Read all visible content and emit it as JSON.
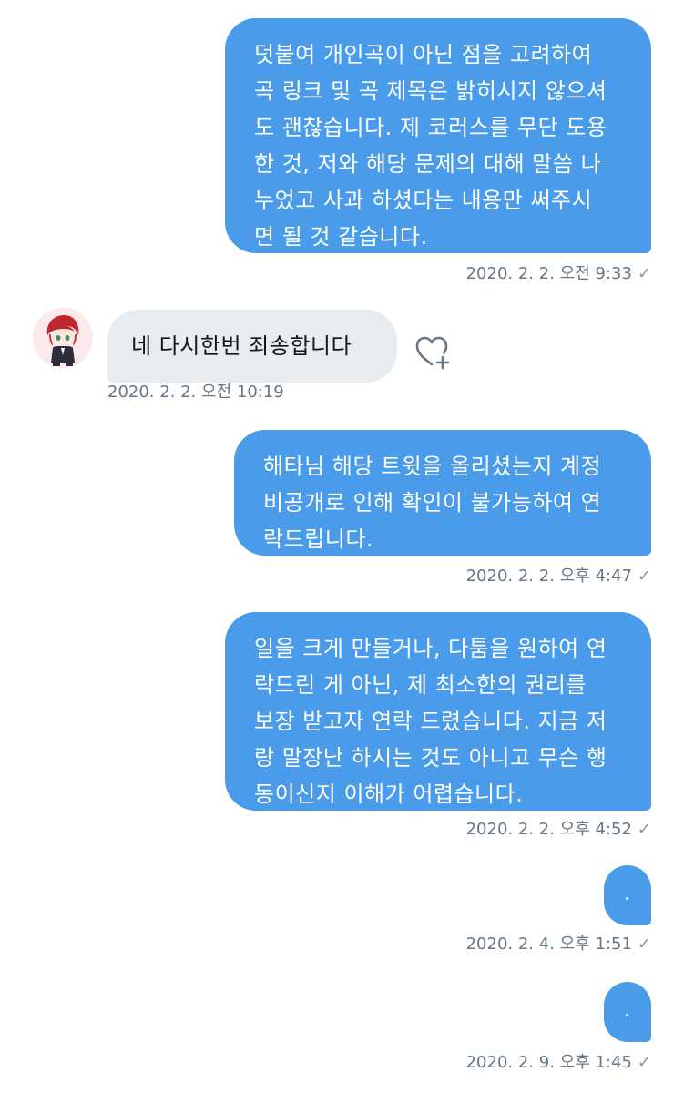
{
  "messages": [
    {
      "id": "msg-1",
      "direction": "outgoing",
      "text": "덧붙여 개인곡이 아닌 점을 고려하여\n곡 링크 및 곡 제목은 밝히시지 않으셔\n도 괜찮습니다. 제 코러스를 무단 도용\n한 것, 저와 해당 문제의 대해 말씀 나\n누었고 사과 하셨다는 내용만 써주시\n면 될 것 같습니다.",
      "timestamp": "2020. 2. 2. 오전 9:33"
    },
    {
      "id": "msg-2",
      "direction": "incoming",
      "text": "네  다시한번 죄송합니다",
      "timestamp": "2020. 2. 2. 오전 10:19"
    },
    {
      "id": "msg-3",
      "direction": "outgoing",
      "text": "해타님 해당 트윗을 올리셨는지 계정\n비공개로 인해 확인이 불가능하여 연\n락드립니다.",
      "timestamp": "2020. 2. 2. 오후 4:47"
    },
    {
      "id": "msg-4",
      "direction": "outgoing",
      "text": "일을 크게 만들거나, 다툼을 원하여 연\n락드린 게 아닌, 제 최소한의 권리를\n보장 받고자 연락 드렸습니다. 지금 저\n랑 말장난 하시는 것도 아니고 무슨 행\n동이신지 이해가 어렵습니다.",
      "timestamp": "2020. 2. 2. 오후 4:52"
    },
    {
      "id": "msg-5",
      "direction": "outgoing",
      "text": ".",
      "timestamp": "2020. 2. 4. 오후 1:51"
    },
    {
      "id": "msg-6",
      "direction": "outgoing",
      "text": ".",
      "timestamp": "2020. 2. 9. 오후 1:45"
    }
  ],
  "read_check": "✓",
  "icons": {
    "avatar": "avatar-anime-character",
    "react": "heart-plus-icon",
    "sent": "checkmark-icon"
  },
  "colors": {
    "outgoing_bubble": "#4a9bea",
    "incoming_bubble": "#e6ecf0",
    "timestamp": "#657786"
  }
}
